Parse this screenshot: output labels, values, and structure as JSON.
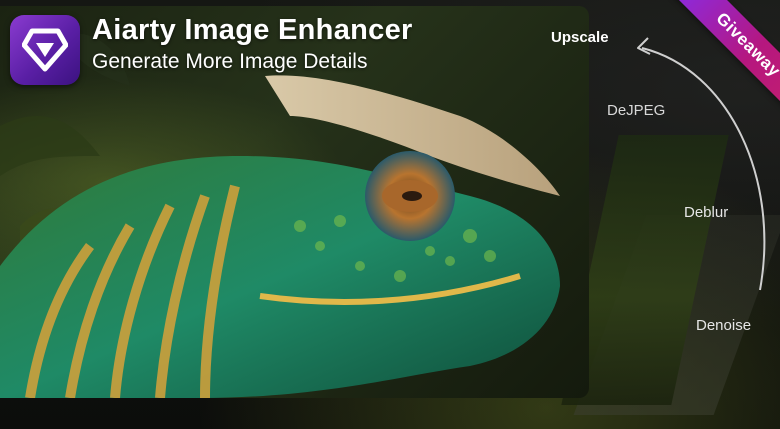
{
  "banner": {
    "title": "Aiarty Image Enhancer",
    "subtitle": "Generate More Image Details",
    "logo_icon": "aiarty-logo-icon",
    "ribbon_text": "Giveaway"
  },
  "steps": [
    "Upscale",
    "DeJPEG",
    "Deblur",
    "Denoise"
  ],
  "colors": {
    "ribbon_start": "#8a2be2",
    "ribbon_end": "#c51f6d",
    "logo_purple": "#6a26b8"
  }
}
